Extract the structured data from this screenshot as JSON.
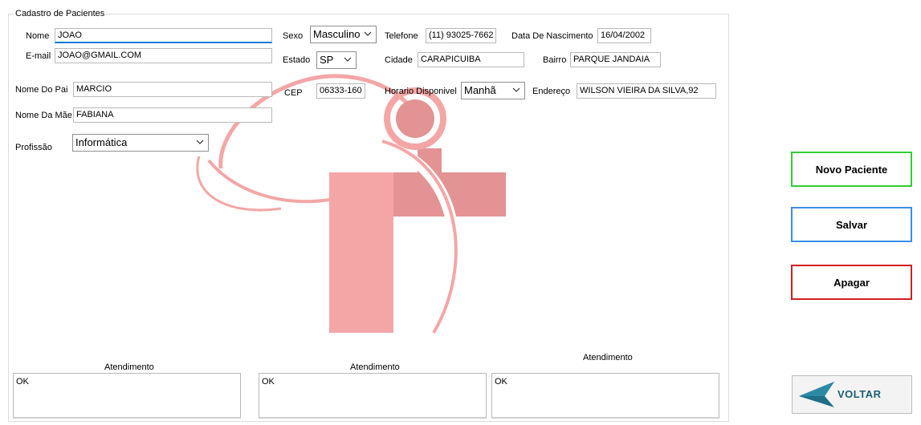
{
  "group": {
    "title": "Cadastro de Pacientes"
  },
  "fields": {
    "nome": {
      "label": "Nome",
      "value": "JOAO"
    },
    "email": {
      "label": "E-mail",
      "value": "JOAO@GMAIL.COM"
    },
    "sexo": {
      "label": "Sexo",
      "value": "Masculino"
    },
    "estado": {
      "label": "Estado",
      "value": "SP"
    },
    "telefone": {
      "label": "Telefone",
      "value": "(11) 93025-7662"
    },
    "cidade": {
      "label": "Cidade",
      "value": "CARAPICUIBA"
    },
    "nascimento": {
      "label": "Data De Nascimento",
      "value": "16/04/2002"
    },
    "bairro": {
      "label": "Bairro",
      "value": "PARQUE JANDAIA"
    },
    "pai": {
      "label": "Nome Do Pai",
      "value": "MARCIO"
    },
    "mae": {
      "label": "Nome Da Mãe",
      "value": "FABIANA"
    },
    "cep": {
      "label": "CEP",
      "value": "06333-160"
    },
    "horario": {
      "label": "Horario Disponivel",
      "value": "Manhã"
    },
    "endereco": {
      "label": "Endereço",
      "value": "WILSON VIEIRA DA SILVA,92"
    },
    "profissao": {
      "label": "Profissão",
      "value": "Informática"
    }
  },
  "atendimentos": [
    {
      "label": "Atendimento",
      "value": "OK"
    },
    {
      "label": "Atendimento",
      "value": "OK"
    },
    {
      "label": "Atendimento",
      "value": "OK"
    }
  ],
  "buttons": {
    "novo": "Novo Paciente",
    "salvar": "Salvar",
    "apagar": "Apagar",
    "voltar": "VOLTAR"
  },
  "colors": {
    "logo_cross": "#f4a6a6",
    "logo_cross_dark": "#e39393",
    "novo_border": "#33cc33",
    "salvar_border": "#3a8ee6",
    "apagar_border": "#d11f1f",
    "voltar_arrow": "#1f6f86",
    "voltar_text": "#1d5f73"
  },
  "icons": {
    "logo": "medical-cross-logo",
    "back": "back-arrow-icon",
    "dropdown": "chevron-down-icon"
  }
}
